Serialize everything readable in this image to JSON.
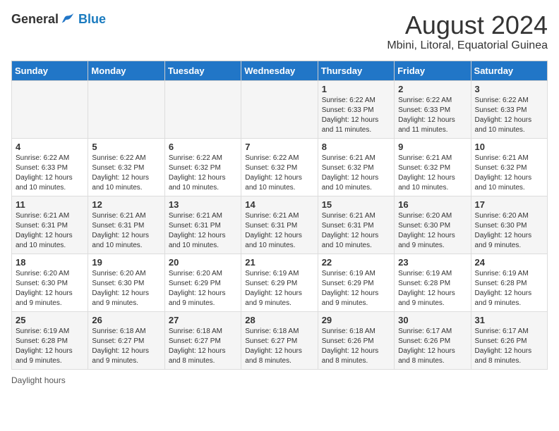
{
  "logo": {
    "general": "General",
    "blue": "Blue"
  },
  "title": "August 2024",
  "subtitle": "Mbini, Litoral, Equatorial Guinea",
  "days_of_week": [
    "Sunday",
    "Monday",
    "Tuesday",
    "Wednesday",
    "Thursday",
    "Friday",
    "Saturday"
  ],
  "footer_text": "Daylight hours",
  "weeks": [
    [
      {
        "num": "",
        "detail": ""
      },
      {
        "num": "",
        "detail": ""
      },
      {
        "num": "",
        "detail": ""
      },
      {
        "num": "",
        "detail": ""
      },
      {
        "num": "1",
        "detail": "Sunrise: 6:22 AM\nSunset: 6:33 PM\nDaylight: 12 hours and 11 minutes."
      },
      {
        "num": "2",
        "detail": "Sunrise: 6:22 AM\nSunset: 6:33 PM\nDaylight: 12 hours and 11 minutes."
      },
      {
        "num": "3",
        "detail": "Sunrise: 6:22 AM\nSunset: 6:33 PM\nDaylight: 12 hours and 10 minutes."
      }
    ],
    [
      {
        "num": "4",
        "detail": "Sunrise: 6:22 AM\nSunset: 6:33 PM\nDaylight: 12 hours and 10 minutes."
      },
      {
        "num": "5",
        "detail": "Sunrise: 6:22 AM\nSunset: 6:32 PM\nDaylight: 12 hours and 10 minutes."
      },
      {
        "num": "6",
        "detail": "Sunrise: 6:22 AM\nSunset: 6:32 PM\nDaylight: 12 hours and 10 minutes."
      },
      {
        "num": "7",
        "detail": "Sunrise: 6:22 AM\nSunset: 6:32 PM\nDaylight: 12 hours and 10 minutes."
      },
      {
        "num": "8",
        "detail": "Sunrise: 6:21 AM\nSunset: 6:32 PM\nDaylight: 12 hours and 10 minutes."
      },
      {
        "num": "9",
        "detail": "Sunrise: 6:21 AM\nSunset: 6:32 PM\nDaylight: 12 hours and 10 minutes."
      },
      {
        "num": "10",
        "detail": "Sunrise: 6:21 AM\nSunset: 6:32 PM\nDaylight: 12 hours and 10 minutes."
      }
    ],
    [
      {
        "num": "11",
        "detail": "Sunrise: 6:21 AM\nSunset: 6:31 PM\nDaylight: 12 hours and 10 minutes."
      },
      {
        "num": "12",
        "detail": "Sunrise: 6:21 AM\nSunset: 6:31 PM\nDaylight: 12 hours and 10 minutes."
      },
      {
        "num": "13",
        "detail": "Sunrise: 6:21 AM\nSunset: 6:31 PM\nDaylight: 12 hours and 10 minutes."
      },
      {
        "num": "14",
        "detail": "Sunrise: 6:21 AM\nSunset: 6:31 PM\nDaylight: 12 hours and 10 minutes."
      },
      {
        "num": "15",
        "detail": "Sunrise: 6:21 AM\nSunset: 6:31 PM\nDaylight: 12 hours and 10 minutes."
      },
      {
        "num": "16",
        "detail": "Sunrise: 6:20 AM\nSunset: 6:30 PM\nDaylight: 12 hours and 9 minutes."
      },
      {
        "num": "17",
        "detail": "Sunrise: 6:20 AM\nSunset: 6:30 PM\nDaylight: 12 hours and 9 minutes."
      }
    ],
    [
      {
        "num": "18",
        "detail": "Sunrise: 6:20 AM\nSunset: 6:30 PM\nDaylight: 12 hours and 9 minutes."
      },
      {
        "num": "19",
        "detail": "Sunrise: 6:20 AM\nSunset: 6:30 PM\nDaylight: 12 hours and 9 minutes."
      },
      {
        "num": "20",
        "detail": "Sunrise: 6:20 AM\nSunset: 6:29 PM\nDaylight: 12 hours and 9 minutes."
      },
      {
        "num": "21",
        "detail": "Sunrise: 6:19 AM\nSunset: 6:29 PM\nDaylight: 12 hours and 9 minutes."
      },
      {
        "num": "22",
        "detail": "Sunrise: 6:19 AM\nSunset: 6:29 PM\nDaylight: 12 hours and 9 minutes."
      },
      {
        "num": "23",
        "detail": "Sunrise: 6:19 AM\nSunset: 6:28 PM\nDaylight: 12 hours and 9 minutes."
      },
      {
        "num": "24",
        "detail": "Sunrise: 6:19 AM\nSunset: 6:28 PM\nDaylight: 12 hours and 9 minutes."
      }
    ],
    [
      {
        "num": "25",
        "detail": "Sunrise: 6:19 AM\nSunset: 6:28 PM\nDaylight: 12 hours and 9 minutes."
      },
      {
        "num": "26",
        "detail": "Sunrise: 6:18 AM\nSunset: 6:27 PM\nDaylight: 12 hours and 9 minutes."
      },
      {
        "num": "27",
        "detail": "Sunrise: 6:18 AM\nSunset: 6:27 PM\nDaylight: 12 hours and 8 minutes."
      },
      {
        "num": "28",
        "detail": "Sunrise: 6:18 AM\nSunset: 6:27 PM\nDaylight: 12 hours and 8 minutes."
      },
      {
        "num": "29",
        "detail": "Sunrise: 6:18 AM\nSunset: 6:26 PM\nDaylight: 12 hours and 8 minutes."
      },
      {
        "num": "30",
        "detail": "Sunrise: 6:17 AM\nSunset: 6:26 PM\nDaylight: 12 hours and 8 minutes."
      },
      {
        "num": "31",
        "detail": "Sunrise: 6:17 AM\nSunset: 6:26 PM\nDaylight: 12 hours and 8 minutes."
      }
    ]
  ]
}
